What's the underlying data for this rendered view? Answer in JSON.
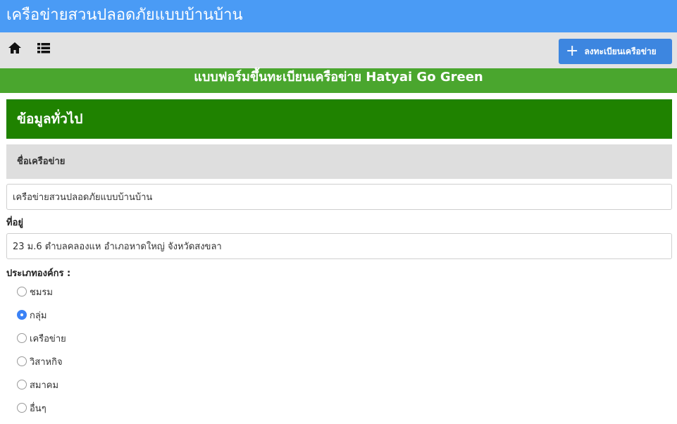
{
  "app": {
    "title": "เครือข่ายสวนปลอดภัยแบบบ้านบ้าน"
  },
  "navbar": {
    "home_icon": "home-icon",
    "list_icon": "list-icon",
    "register_button": {
      "icon": "plus-icon",
      "label": "ลงทะเบียนเครือข่าย"
    }
  },
  "banner": {
    "title": "แบบฟอร์มขึ้นทะเบียนเครือข่าย Hatyai Go Green"
  },
  "form": {
    "section_title": "ข้อมูลทั่วไป",
    "network_name": {
      "label": "ชื่อเครือข่าย",
      "value": "เครือข่ายสวนปลอดภัยแบบบ้านบ้าน"
    },
    "address": {
      "label": "ที่อยู่",
      "value": "23 ม.6 ตำบลคลองแห อำเภอหาดใหญ่ จังหวัดสงขลา"
    },
    "org_type": {
      "label": "ประเภทองค์กร :",
      "selected": "กลุ่ม",
      "options": [
        {
          "label": "ชมรม",
          "checked": false
        },
        {
          "label": "กลุ่ม",
          "checked": true
        },
        {
          "label": "เครือข่าย",
          "checked": false
        },
        {
          "label": "วิสาหกิจ",
          "checked": false
        },
        {
          "label": "สมาคม",
          "checked": false
        },
        {
          "label": "อื่นๆ",
          "checked": false
        }
      ]
    }
  },
  "colors": {
    "topbar": "#4a9bf5",
    "navbar": "#e3e3e3",
    "button": "#3d86e0",
    "banner": "#4aa62e",
    "section": "#1f8200",
    "subhead": "#dedede"
  }
}
